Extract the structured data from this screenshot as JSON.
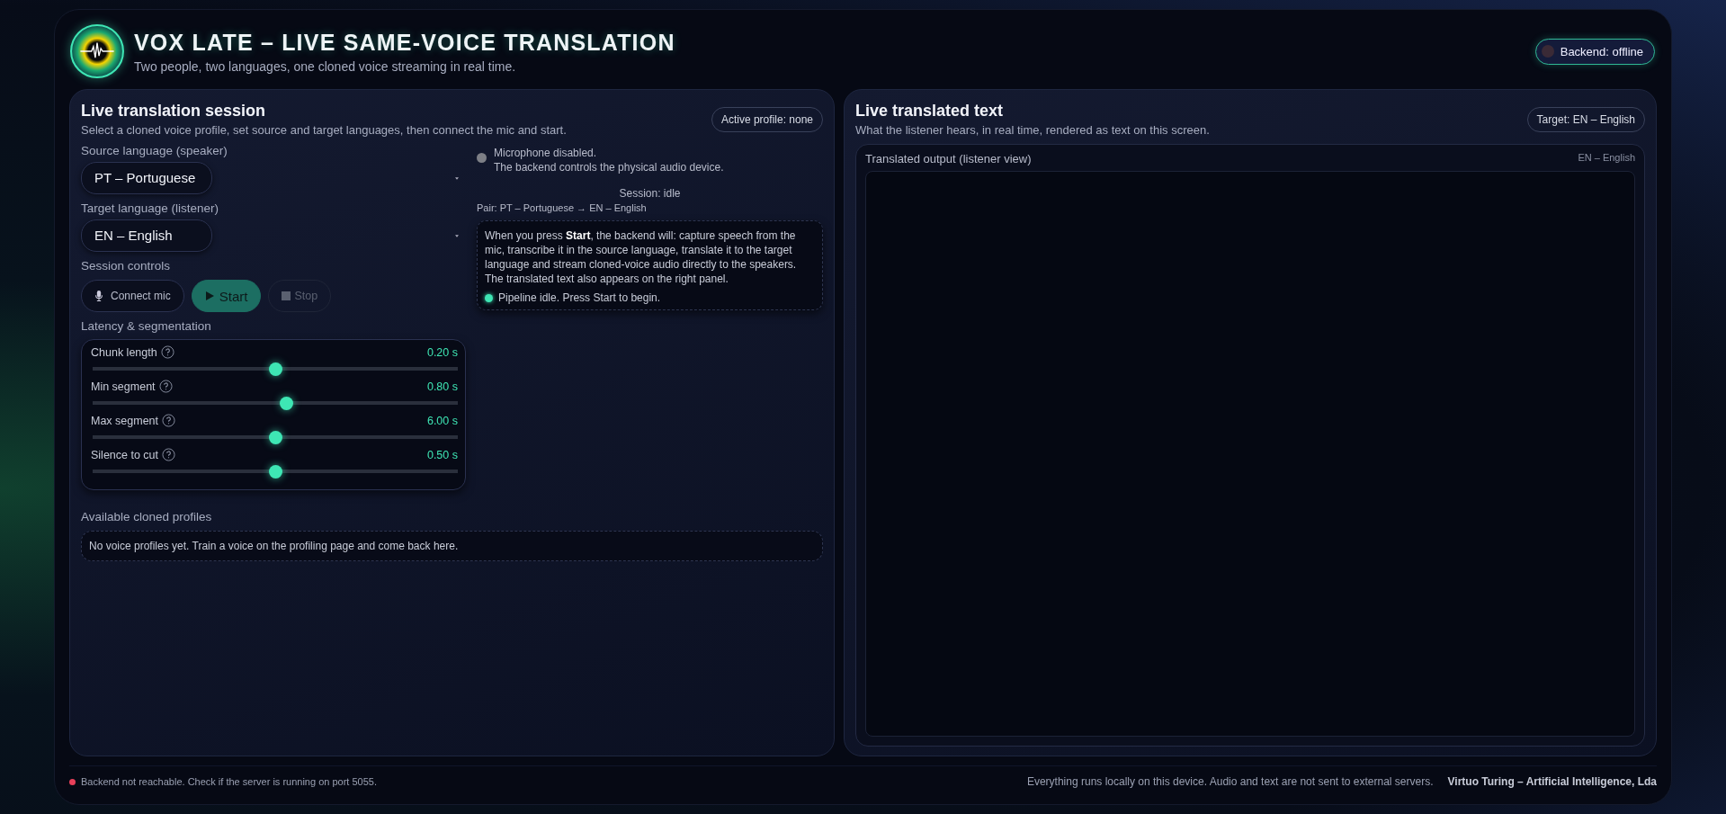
{
  "header": {
    "title": "VOX LATE – LIVE SAME-VOICE TRANSLATION",
    "subtitle": "Two people, two languages, one cloned voice streaming in real time.",
    "backend": {
      "label": "Backend: offline",
      "online": false
    }
  },
  "session": {
    "title": "Live translation session",
    "subtitle": "Select a cloned voice profile, set source and target languages, then connect the mic and start.",
    "badge": "Active profile: none",
    "fields": [
      {
        "label": "Source language (speaker)",
        "value": "PT – Portuguese"
      },
      {
        "label": "Target language (listener)",
        "value": "EN – English"
      }
    ],
    "controls_label": "Session controls",
    "buttons": [
      {
        "kind": "mic",
        "label": "Connect mic",
        "disabled": false
      },
      {
        "kind": "start",
        "label": "Start",
        "disabled": false
      },
      {
        "kind": "stop",
        "label": "Stop",
        "disabled": true
      }
    ],
    "latency_label": "Latency & segmentation",
    "sliders": [
      {
        "label": "Chunk length",
        "reading": "0.20 s",
        "level": 0.5
      },
      {
        "label": "Min segment",
        "reading": "0.80 s",
        "level": 0.53
      },
      {
        "label": "Max segment",
        "reading": "6.00 s",
        "level": 0.5
      },
      {
        "label": "Silence to cut",
        "reading": "0.50 s",
        "level": 0.5
      }
    ],
    "profiles_label": "Available cloned profiles",
    "profiles_empty": "No voice profiles yet. Train a voice on the profiling page and come back here.",
    "mic": {
      "enabled": false,
      "lines": [
        "Microphone disabled.",
        "The backend controls the physical audio device."
      ]
    },
    "status": "Session: idle",
    "pair": "Pair: PT – Portuguese → EN – English",
    "info": {
      "text": "When you press **Start**, the backend will: capture speech from the mic, transcribe it in the source language, translate it to the target language and stream cloned-voice audio directly to the speakers. The translated text also appears on the right panel.",
      "pipeline": "Pipeline idle. Press Start to begin."
    }
  },
  "output": {
    "title": "Live translated text",
    "subtitle": "What the listener hears, in real time, rendered as text on this screen.",
    "badge": "Target: EN – English",
    "label": "Translated output (listener view)",
    "lang": "EN – English"
  },
  "footer": {
    "status": "Backend not reachable. Check if the server is running on port 5055.",
    "reachable": false,
    "note": "Everything runs locally on this device. Audio and text are not sent to external servers.",
    "credit": "Virtuo Turing – Artificial Intelligence, Lda"
  }
}
